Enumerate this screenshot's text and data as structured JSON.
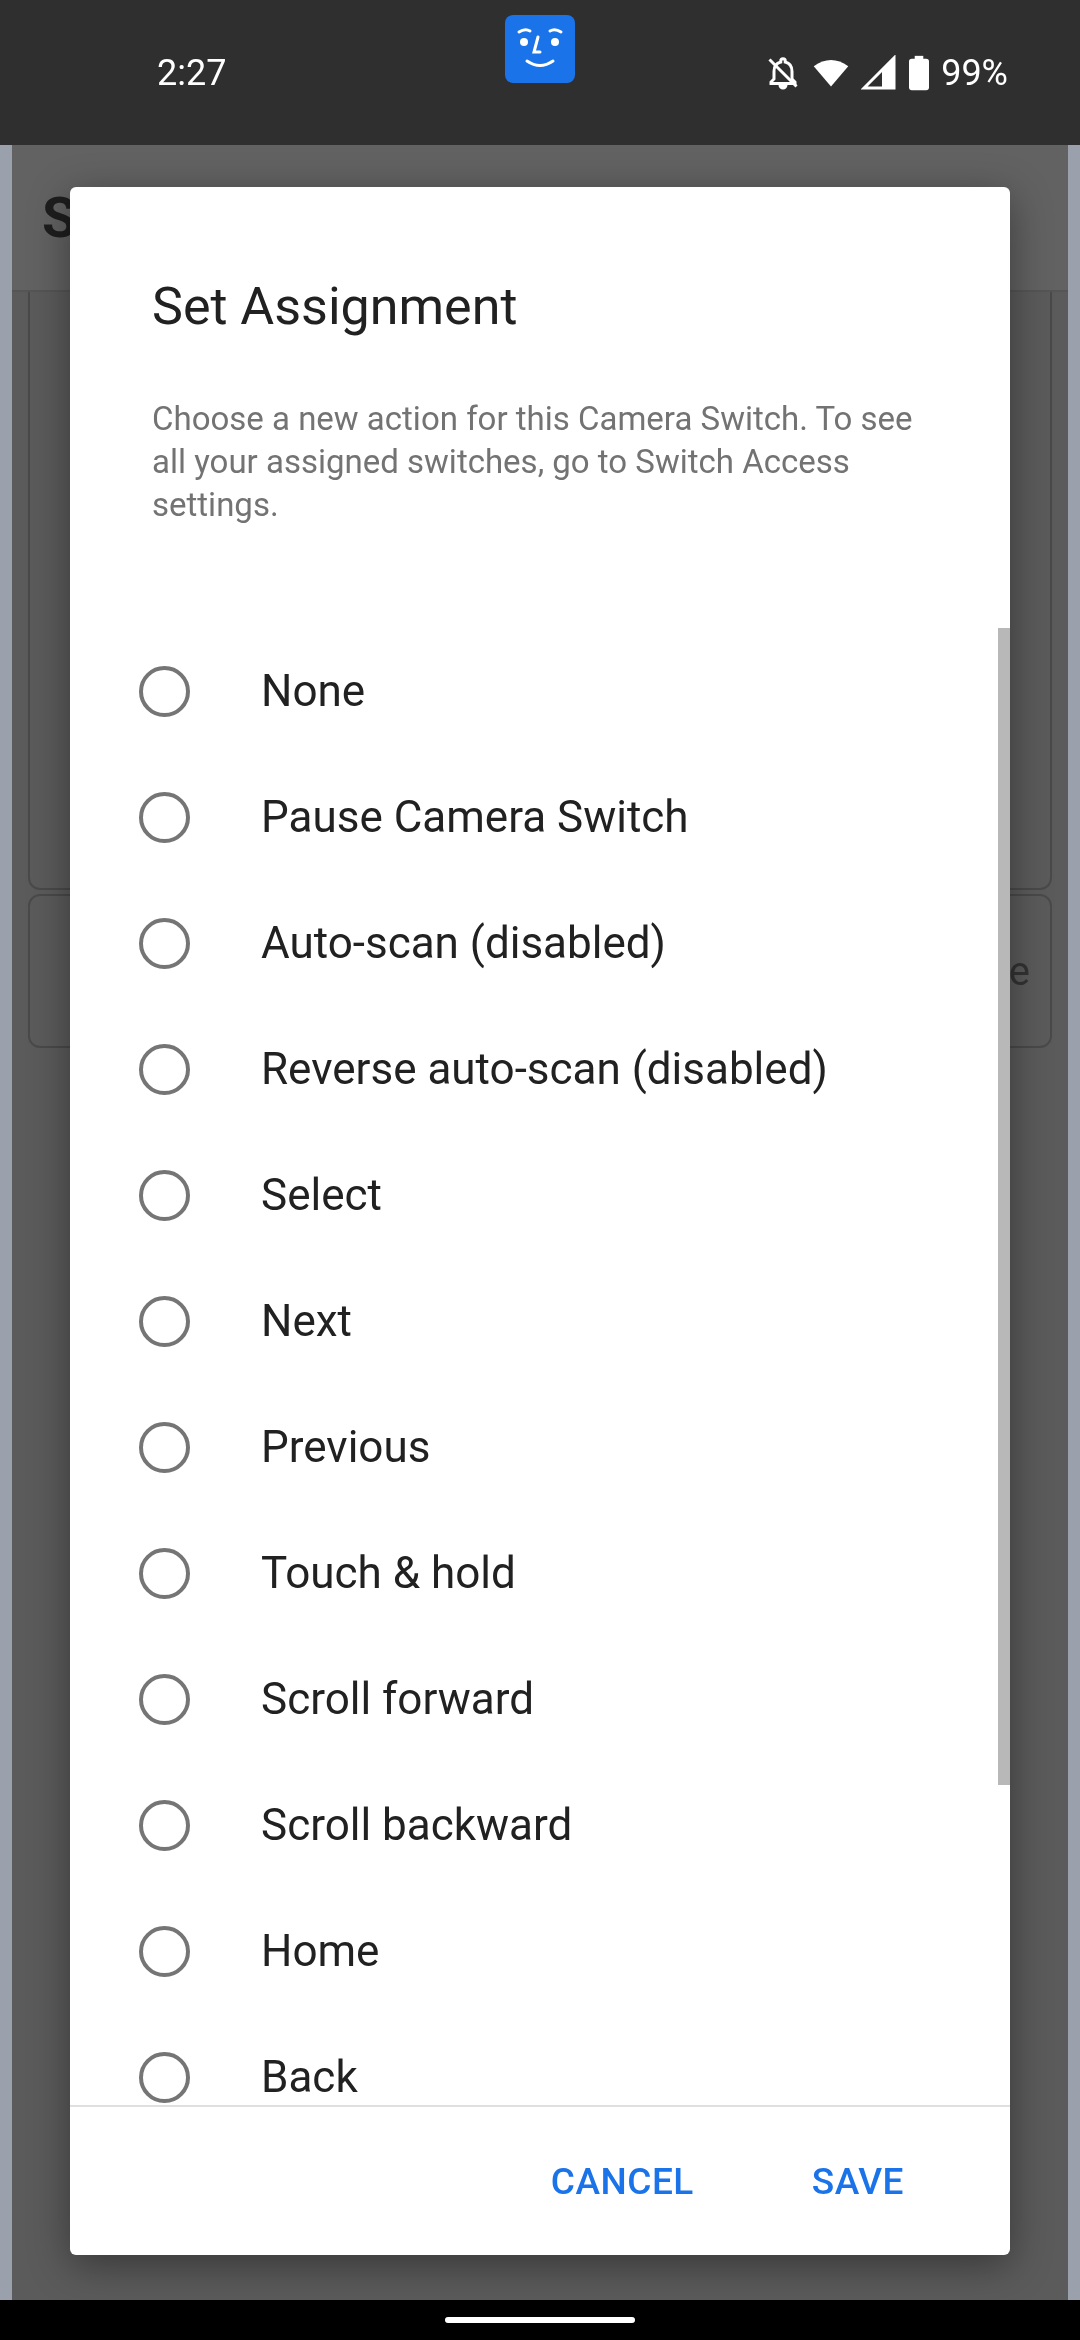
{
  "status_bar": {
    "time": "2:27",
    "battery": "99%"
  },
  "background": {
    "title": "S",
    "card_text": "e"
  },
  "dialog": {
    "title": "Set Assignment",
    "description": "Choose a new action for this Camera Switch. To see all your assigned switches, go to Switch Access settings.",
    "options": [
      {
        "label": "None",
        "selected": false
      },
      {
        "label": "Pause Camera Switch",
        "selected": false
      },
      {
        "label": "Auto-scan (disabled)",
        "selected": false
      },
      {
        "label": "Reverse auto-scan (disabled)",
        "selected": false
      },
      {
        "label": "Select",
        "selected": false
      },
      {
        "label": "Next",
        "selected": false
      },
      {
        "label": "Previous",
        "selected": false
      },
      {
        "label": "Touch & hold",
        "selected": false
      },
      {
        "label": "Scroll forward",
        "selected": false
      },
      {
        "label": "Scroll backward",
        "selected": false
      },
      {
        "label": "Home",
        "selected": false
      },
      {
        "label": "Back",
        "selected": false
      }
    ],
    "buttons": [
      "CANCEL",
      "SAVE"
    ]
  }
}
